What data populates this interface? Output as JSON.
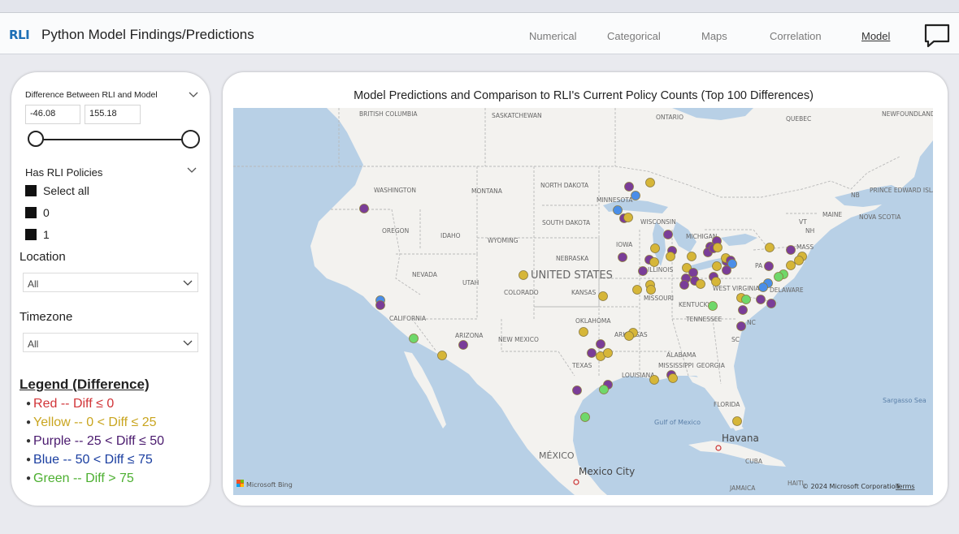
{
  "header": {
    "logo_text": "RLI",
    "title": "Python Model Findings/Predictions",
    "nav": [
      "Numerical",
      "Categorical",
      "Maps",
      "Correlation",
      "Model"
    ],
    "active_nav": "Model"
  },
  "filters": {
    "difference": {
      "label": "Difference Between RLI and Model",
      "min_value": "-46.08",
      "max_value": "155.18"
    },
    "has_policies": {
      "label": "Has RLI Policies",
      "options": [
        "Select all",
        "0",
        "1"
      ]
    },
    "location": {
      "label": "Location",
      "value": "All"
    },
    "timezone": {
      "label": "Timezone",
      "value": "All"
    }
  },
  "legend": {
    "title": "Legend (Difference)",
    "items": [
      {
        "text": "Red -- Diff ≤ 0",
        "color": "#d13438"
      },
      {
        "text": "Yellow -- 0 < Diff ≤ 25",
        "color": "#c9a51f"
      },
      {
        "text": "Purple -- 25 < Diff ≤ 50",
        "color": "#4a1a6e"
      },
      {
        "text": "Blue -- 50 < Diff ≤ 75",
        "color": "#1a3ea0"
      },
      {
        "text": "Green -- Diff > 75",
        "color": "#4caf30"
      }
    ]
  },
  "map": {
    "title": "Model Predictions and Comparison to RLI's Current Policy Counts (Top 100 Differences)",
    "labels": {
      "country_us": "UNITED STATES",
      "mexico": "MÉXICO",
      "mexico_city": "Mexico City",
      "havana": "Havana",
      "cuba": "CUBA",
      "gulf": "Gulf of Mexico",
      "sargasso": "Sargasso Sea",
      "jamaica": "JAMAICA",
      "haiti": "HAITI",
      "bc": "BRITISH COLUMBIA",
      "sask": "SASKATCHEWAN",
      "ontario": "ONTARIO",
      "quebec": "QUEBEC",
      "nfld": "NEWFOUNDLAND AND LABRADOR",
      "nb": "NB",
      "pei": "PRINCE EDWARD ISLAND",
      "ns": "NOVA SCOTIA",
      "maine": "MAINE",
      "vt": "VT",
      "nh": "NH",
      "mass": "MASS",
      "pa": "PA",
      "delaware": "DELAWARE",
      "nc": "NC",
      "sc": "SC",
      "west_virginia": "WEST VIRGINIA",
      "washington": "WASHINGTON",
      "oregon": "OREGON",
      "california": "CALIFORNIA",
      "nevada": "NEVADA",
      "idaho": "IDAHO",
      "montana": "MONTANA",
      "wyoming": "WYOMING",
      "utah": "UTAH",
      "arizona": "ARIZONA",
      "colorado": "COLORADO",
      "new_mexico": "NEW MEXICO",
      "north_dakota": "NORTH DAKOTA",
      "south_dakota": "SOUTH DAKOTA",
      "nebraska": "NEBRASKA",
      "kansas": "KANSAS",
      "oklahoma": "OKLAHOMA",
      "texas": "TEXAS",
      "minnesota": "MINNESOTA",
      "iowa": "IOWA",
      "missouri": "MISSOURI",
      "arkansas": "ARKANSAS",
      "louisiana": "LOUISIANA",
      "wisconsin": "WISCONSIN",
      "illinois": "ILLINOIS",
      "michigan": "MICHIGAN",
      "kentucky": "KENTUCKY",
      "tennessee": "TENNESSEE",
      "mississippi": "MISSISSIPPI",
      "alabama": "ALABAMA",
      "georgia": "GEORGIA",
      "florida": "FLORIDA",
      "bing": "Microsoft Bing",
      "copyright": "© 2024 Microsoft Corporation",
      "terms": "Terms"
    },
    "colors": {
      "yellow": "#d6b638",
      "purple": "#7a3d98",
      "blue": "#4a8ee8",
      "green": "#6fd86a",
      "water": "#b8d0e6",
      "land": "#f3f2ef"
    }
  }
}
